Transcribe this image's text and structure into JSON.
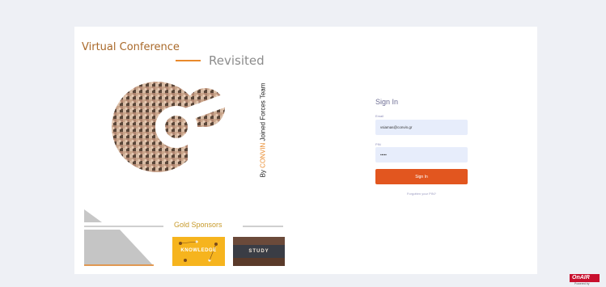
{
  "header": {
    "title": "Virtual Conference",
    "subtitle": "Revisited"
  },
  "tagline": {
    "prefix": "By",
    "brand": "CONVIN",
    "suffix": "Joined Forces Team"
  },
  "signin": {
    "title": "Sign In",
    "email_label": "Email",
    "email_value": "vsiamas@convin.gr",
    "pin_label": "PIN",
    "pin_value": "•••••",
    "button_label": "Sign In",
    "forgot_link": "Forgotten your PIN?"
  },
  "sponsors": {
    "heading": "Gold Sponsors",
    "items": [
      {
        "text": "KNOWLEDGE"
      },
      {
        "text": "STUDY"
      }
    ]
  },
  "watermark": {
    "label": "OnAIR",
    "sub": "Powered by"
  },
  "colors": {
    "accent": "#e2561f",
    "title_brown": "#a9692a",
    "field_bg": "#e7edfb",
    "gold": "#c89a2a"
  }
}
